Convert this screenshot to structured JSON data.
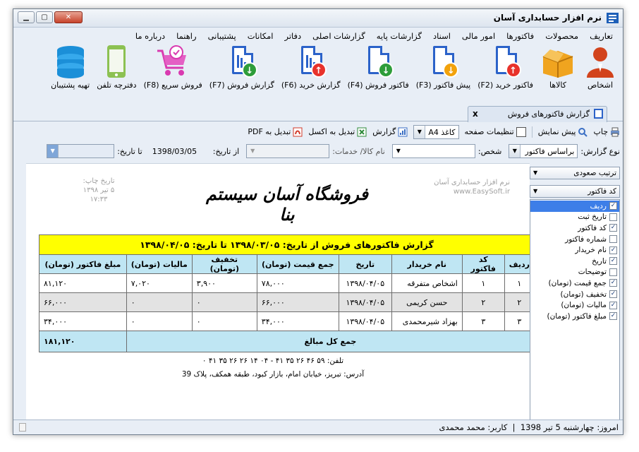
{
  "window": {
    "title": "نرم افزار حسابداری آسان"
  },
  "menu": [
    "تعاریف",
    "محصولات",
    "فاکتورها",
    "امور مالی",
    "اسناد",
    "گزارشات پایه",
    "گزارشات اصلی",
    "دفاتر",
    "امکانات",
    "پشتیبانی",
    "راهنما",
    "درباره ما"
  ],
  "toolbar": [
    {
      "label": "اشخاص",
      "icon": "person-icon"
    },
    {
      "label": "کالاها",
      "icon": "box-icon"
    },
    {
      "label": "فاکتور خرید (F2)",
      "icon": "buy-invoice-icon"
    },
    {
      "label": "پیش فاکتور (F3)",
      "icon": "proforma-icon"
    },
    {
      "label": "فاکتور فروش (F4)",
      "icon": "sell-invoice-icon"
    },
    {
      "label": "گزارش خرید (F6)",
      "icon": "buy-report-icon"
    },
    {
      "label": "گزارش فروش (F7)",
      "icon": "sell-report-icon"
    },
    {
      "label": "فروش سریع (F8)",
      "icon": "cart-icon"
    },
    {
      "label": "دفترچه تلفن",
      "icon": "phone-icon"
    },
    {
      "label": "تهیه پشتیبان",
      "icon": "database-icon"
    }
  ],
  "tab": {
    "label": "گزارش فاکتورهای فروش",
    "close": "x"
  },
  "report_toolbar": {
    "print": "چاپ",
    "preview": "پیش نمایش",
    "page_settings": "تنظیمات صفحه",
    "paper": "کاغذ A4",
    "report": "گزارش",
    "to_excel": "تبدیل به اکسل",
    "to_pdf": "تبدیل به PDF"
  },
  "filters": {
    "report_type_label": "نوع گزارش:",
    "report_type_value": "براساس فاکتور",
    "person_label": "شخص:",
    "goods_label": "نام کالا/ خدمات:",
    "from_label": "از تاریخ:",
    "from_value": "1398/03/05",
    "to_label": "تا تاریخ:"
  },
  "report": {
    "stamp_left": [
      "تاریخ چاپ:",
      "۵ تیر ۱۳۹۸",
      "۱۷:۳۳"
    ],
    "stamp_right": [
      "نرم افزار حسابداری آسان",
      "www.EasySoft.ir"
    ],
    "shop_name": "فروشگاه آسان سیستم بنا",
    "heading": "گزارش فاکتورهای فروش از تاریخ: ۱۳۹۸/۰۳/۰۵ تا تاریخ: ۱۳۹۸/۰۴/۰۵",
    "columns": [
      "ردیف",
      "کد فاکتور",
      "نام خریدار",
      "تاریخ",
      "جمع قیمت (تومان)",
      "تخفیف (تومان)",
      "مالیات (تومان)",
      "مبلغ فاکتور (تومان)"
    ],
    "rows": [
      [
        "۱",
        "۱",
        "اشخاص متفرقه",
        "۱۳۹۸/۰۴/۰۵",
        "۷۸,۰۰۰",
        "۳,۹۰۰",
        "۷,۰۲۰",
        "۸۱,۱۲۰"
      ],
      [
        "۲",
        "۲",
        "حسن کریمی",
        "۱۳۹۸/۰۴/۰۵",
        "۶۶,۰۰۰",
        "۰",
        "۰",
        "۶۶,۰۰۰"
      ],
      [
        "۳",
        "۳",
        "بهزاد شیرمحمدی",
        "۱۳۹۸/۰۴/۰۵",
        "۳۴,۰۰۰",
        "۰",
        "۰",
        "۳۴,۰۰۰"
      ]
    ],
    "total_label": "جمع کل مبالغ",
    "total_value": "۱۸۱,۱۲۰",
    "phone": "تلفن: ۵۹ ۴۶ ۲۶ ۳۵ ۴۱ - ۰۴ ۱۴ ۲۶ ۲۶ ۳۵ ۴۱ ۰",
    "address": "آدرس: تبریز، خیابان امام، بازار کبود، طبقه همکف، پلاک 39"
  },
  "side_panel": {
    "sort": "ترتیب صعودی",
    "field": "کد فاکتور",
    "fields": [
      {
        "label": "ردیف",
        "checked": true,
        "selected": true
      },
      {
        "label": "تاریخ ثبت",
        "checked": false
      },
      {
        "label": "کد فاکتور",
        "checked": true
      },
      {
        "label": "شماره فاکتور",
        "checked": false
      },
      {
        "label": "نام خریدار",
        "checked": true
      },
      {
        "label": "تاریخ",
        "checked": true
      },
      {
        "label": "توضیحات",
        "checked": false
      },
      {
        "label": "جمع قیمت (تومان)",
        "checked": true
      },
      {
        "label": "تخفیف (تومان)",
        "checked": true
      },
      {
        "label": "مالیات (تومان)",
        "checked": true
      },
      {
        "label": "مبلغ فاکتور (تومان)",
        "checked": true
      }
    ]
  },
  "status": {
    "today": "امروز: چهارشنبه 5 تیر 1398",
    "separator": "|",
    "user": "کاربر: محمد محمدی"
  },
  "colors": {
    "accent_blue": "#2b62c9",
    "header_yellow": "#ffff00",
    "header_cyan": "#bfe6f3",
    "arrow_red": "#e8322b",
    "arrow_green": "#2e9d3a",
    "arrow_orange": "#f2a20c"
  }
}
